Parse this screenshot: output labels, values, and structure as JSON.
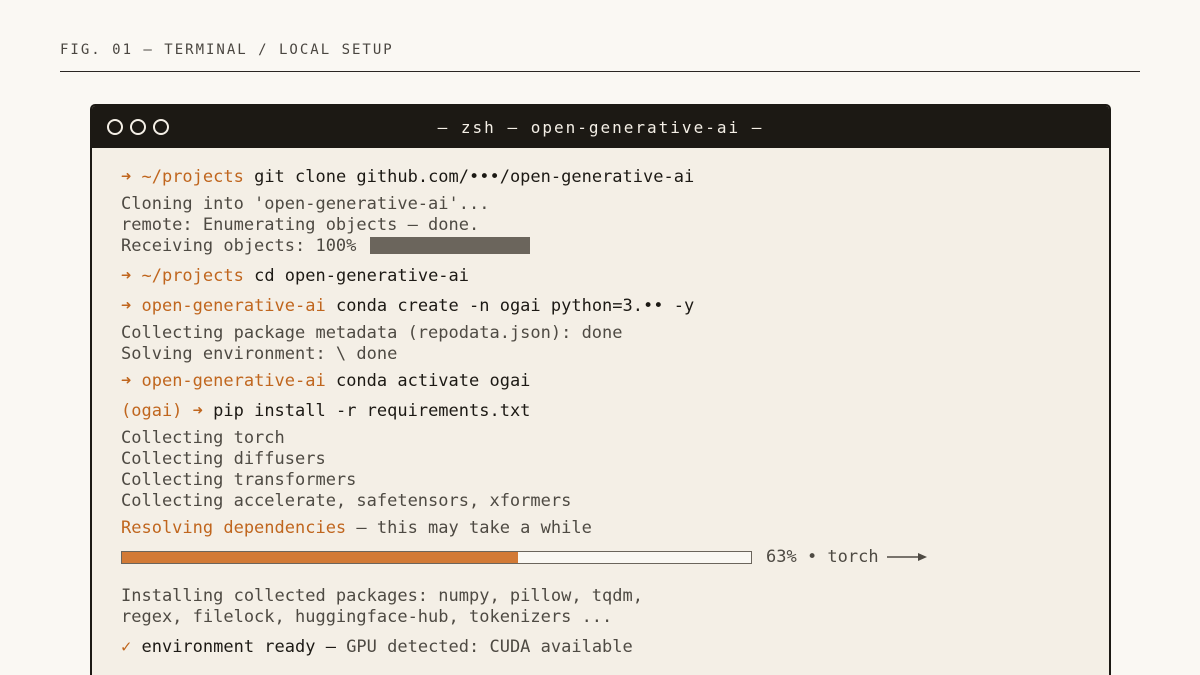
{
  "figure": {
    "caption": "FIG. 01 — TERMINAL / LOCAL SETUP"
  },
  "window": {
    "title": "— zsh — open-generative-ai —",
    "controls": [
      "window-dot",
      "window-dot",
      "window-dot"
    ]
  },
  "terminal": {
    "prompt_arrow": "➜",
    "block1": {
      "cwd": " ~/projects ",
      "command": "git clone github.com/•••/open-generative-ai",
      "output": [
        "Cloning into 'open-generative-ai'...",
        "remote: Enumerating objects — done."
      ],
      "receiving": "Receiving objects: 100% ",
      "receiving_progress": 1.0
    },
    "block2": {
      "cwd": " ~/projects ",
      "command": "cd open-generative-ai"
    },
    "block3": {
      "cwd": " open-generative-ai ",
      "command": "conda create -n ogai python=3.•• -y",
      "output": [
        "Collecting package metadata (repodata.json): done",
        "Solving environment: \\ done"
      ]
    },
    "block4": {
      "cwd": " open-generative-ai ",
      "command": "conda activate ogai"
    },
    "block5": {
      "env": "(ogai) ",
      "command": " pip install -r requirements.txt",
      "output": [
        "Collecting torch",
        "Collecting diffusers",
        "Collecting transformers",
        "Collecting accelerate, safetensors, xformers"
      ],
      "resolving_highlight": "Resolving dependencies",
      "resolving_rest": " — this may take a while"
    },
    "progress": {
      "percent": 63,
      "label": "63% • torch"
    },
    "install": {
      "output": [
        "Installing collected packages: numpy, pillow, tqdm,",
        "regex, filelock, huggingface-hub, tokenizers ..."
      ]
    },
    "final": {
      "check": "✓",
      "status": " environment ready — ",
      "detail": "GPU detected: CUDA available"
    }
  },
  "colors": {
    "accent": "#c0661e",
    "progress_fill": "#d27a36",
    "titlebar": "#1c1914",
    "terminal_bg": "#f4efe6"
  }
}
